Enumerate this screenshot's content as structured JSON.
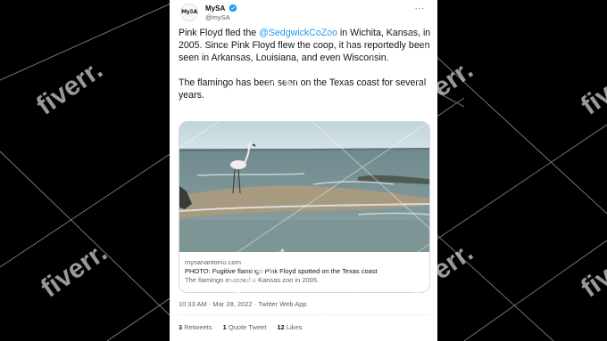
{
  "tweet": {
    "avatar_text": "MySA",
    "display_name": "MySA",
    "handle": "@mySA",
    "more_label": "···",
    "text": {
      "line1_a": "Pink Floyd fled the ",
      "mention": "@SedgwickCoZoo",
      "line1_b": " in Wichita, Kansas, in 2005. Since Pink Floyd flew the coop, it has reportedly been seen in Arkansas, Louisiana, and even Wisconsin.",
      "paragraph2": "The flamingo has been seen on the Texas coast for several years."
    },
    "card": {
      "domain": "mysanantonio.com",
      "title": "PHOTO: Fugitive flamingo Pink Floyd spotted on the Texas coast",
      "description": "The flamingo escaped a Kansas zoo in 2005."
    },
    "timestamp": "10:33 AM · Mar 28, 2022 · Twitter Web App",
    "stats": {
      "retweets_count": "3",
      "retweets_label": "Retweets",
      "quotes_count": "1",
      "quotes_label": "Quote Tweet",
      "likes_count": "12",
      "likes_label": "Likes"
    }
  },
  "watermark_text": "fiverr.",
  "colors": {
    "background": "#000000",
    "mention": "#1d9bf0",
    "verified": "#1d9bf0",
    "secondary_text": "#536471"
  }
}
